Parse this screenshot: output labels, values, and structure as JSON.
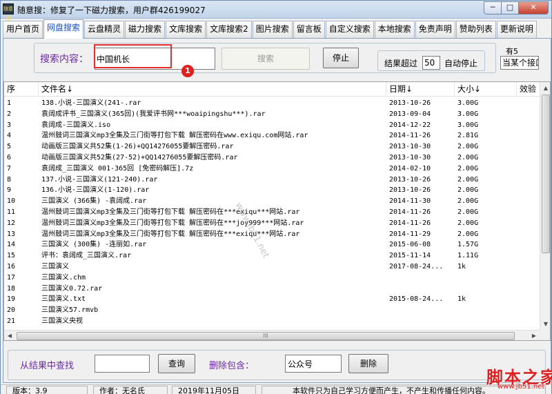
{
  "window": {
    "icon_text": "随意搜",
    "title": "随意搜：修复了一下磁力搜索，用户群426199027",
    "min_symbol": "─",
    "max_symbol": "□",
    "close_symbol": "✕"
  },
  "tabs": [
    {
      "label": "用户首页",
      "active": false
    },
    {
      "label": "网盘搜索",
      "active": true
    },
    {
      "label": "云盘精灵",
      "active": false
    },
    {
      "label": "磁力搜索",
      "active": false
    },
    {
      "label": "文库搜索",
      "active": false
    },
    {
      "label": "文库搜索2",
      "active": false
    },
    {
      "label": "图片搜索",
      "active": false
    },
    {
      "label": "留言板",
      "active": false
    },
    {
      "label": "自定义搜索",
      "active": false
    },
    {
      "label": "本地搜索",
      "active": false
    },
    {
      "label": "免责声明",
      "active": false
    },
    {
      "label": "赞助列表",
      "active": false
    },
    {
      "label": "更新说明",
      "active": false
    }
  ],
  "search": {
    "label": "搜索内容：",
    "value": "中国机长",
    "search_button": "搜索",
    "stop_button": "停止",
    "limit_prefix": "结果超过",
    "limit_value": "50",
    "limit_suffix": "自动停止",
    "side_label": "有5",
    "side_select": "当某个接口",
    "annotation_badge": "1"
  },
  "columns": {
    "idx": "序",
    "name": "文件名↓",
    "date": "日期↓",
    "size": "大小↓",
    "extra": "效验"
  },
  "rows": [
    {
      "idx": "1",
      "name": "138.小说-三国演义(241-.rar",
      "date": "2013-10-26",
      "size": "3.00G"
    },
    {
      "idx": "2",
      "name": "袁阔成评书_三国演义(365回)(我爱评书网***woaipingshu***).rar",
      "date": "2013-09-04",
      "size": "3.00G"
    },
    {
      "idx": "3",
      "name": "袁阔成-三国演义.iso",
      "date": "2014-12-22",
      "size": "3.00G"
    },
    {
      "idx": "4",
      "name": "温州鼓词三国演义mp3全集及三门街等打包下载 解压密码在www.exiqu.com网站.rar",
      "date": "2014-11-26",
      "size": "2.81G"
    },
    {
      "idx": "5",
      "name": "动画版三国演义共52集(1-26)+QQ14276055要解压密码.rar",
      "date": "2013-10-30",
      "size": "2.00G"
    },
    {
      "idx": "6",
      "name": "动画版三国演义共52集(27-52)+QQ14276055要解压密码.rar",
      "date": "2013-10-30",
      "size": "2.00G"
    },
    {
      "idx": "7",
      "name": "袁阔成_三国演义 001-365回 [免密码解压].7z",
      "date": "2014-02-10",
      "size": "2.00G"
    },
    {
      "idx": "8",
      "name": "137.小说-三国演义(121-240).rar",
      "date": "2013-10-26",
      "size": "2.00G"
    },
    {
      "idx": "9",
      "name": "136.小说-三国演义(1-120).rar",
      "date": "2013-10-26",
      "size": "2.00G"
    },
    {
      "idx": "10",
      "name": "三国演义 (366集) -袁阔成.rar",
      "date": "2014-11-30",
      "size": "2.00G"
    },
    {
      "idx": "11",
      "name": "温州鼓词三国演义mp3全集及三门街等打包下载 解压密码在***exiqu***网站.rar",
      "date": "2014-11-26",
      "size": "2.00G"
    },
    {
      "idx": "12",
      "name": "温州鼓词三国演义mp3全集及三门街等打包下载 解压密码在***joy999***网站.rar",
      "date": "2014-11-26",
      "size": "2.00G"
    },
    {
      "idx": "13",
      "name": "温州鼓词三国演义mp3全集及三门街等打包下载 解压密码在***exiqu***网站.rar",
      "date": "2014-11-29",
      "size": "2.00G"
    },
    {
      "idx": "14",
      "name": "三国演义 (300集) -连丽如.rar",
      "date": "2015-06-08",
      "size": "1.57G"
    },
    {
      "idx": "15",
      "name": "评书：袁阔成_三国演义.rar",
      "date": "2015-11-14",
      "size": "1.11G"
    },
    {
      "idx": "16",
      "name": "三国演义",
      "date": "  2017-08-24...",
      "size": "1k"
    },
    {
      "idx": "17",
      "name": "三国演义.chm",
      "date": "",
      "size": ""
    },
    {
      "idx": "18",
      "name": "三国演义0.72.rar",
      "date": "",
      "size": ""
    },
    {
      "idx": "19",
      "name": "三国演义.txt",
      "date": "  2015-08-24...",
      "size": "1k"
    },
    {
      "idx": "20",
      "name": "三国演义57.rmvb",
      "date": "",
      "size": ""
    },
    {
      "idx": "21",
      "name": "三国演义央视",
      "date": "",
      "size": ""
    }
  ],
  "scroll": {
    "up": "▲",
    "down": "▼",
    "left": "◀",
    "right": "▶",
    "grip": "III"
  },
  "filter": {
    "find_label": "从结果中查找",
    "find_value": "",
    "find_button": "查询",
    "exclude_label": "删除包含：",
    "exclude_value": "公众号",
    "exclude_button": "删除"
  },
  "status": {
    "version": "版本：3.9",
    "author": "作者：无名氏",
    "date": "2019年11月05日",
    "notice": "本软件只为自己学习方便而产生，不产生和传播任何内容。"
  },
  "watermark": {
    "diagonal": "www.jb51.net",
    "brand": "脚本之家",
    "url": "www.jb51.net"
  }
}
